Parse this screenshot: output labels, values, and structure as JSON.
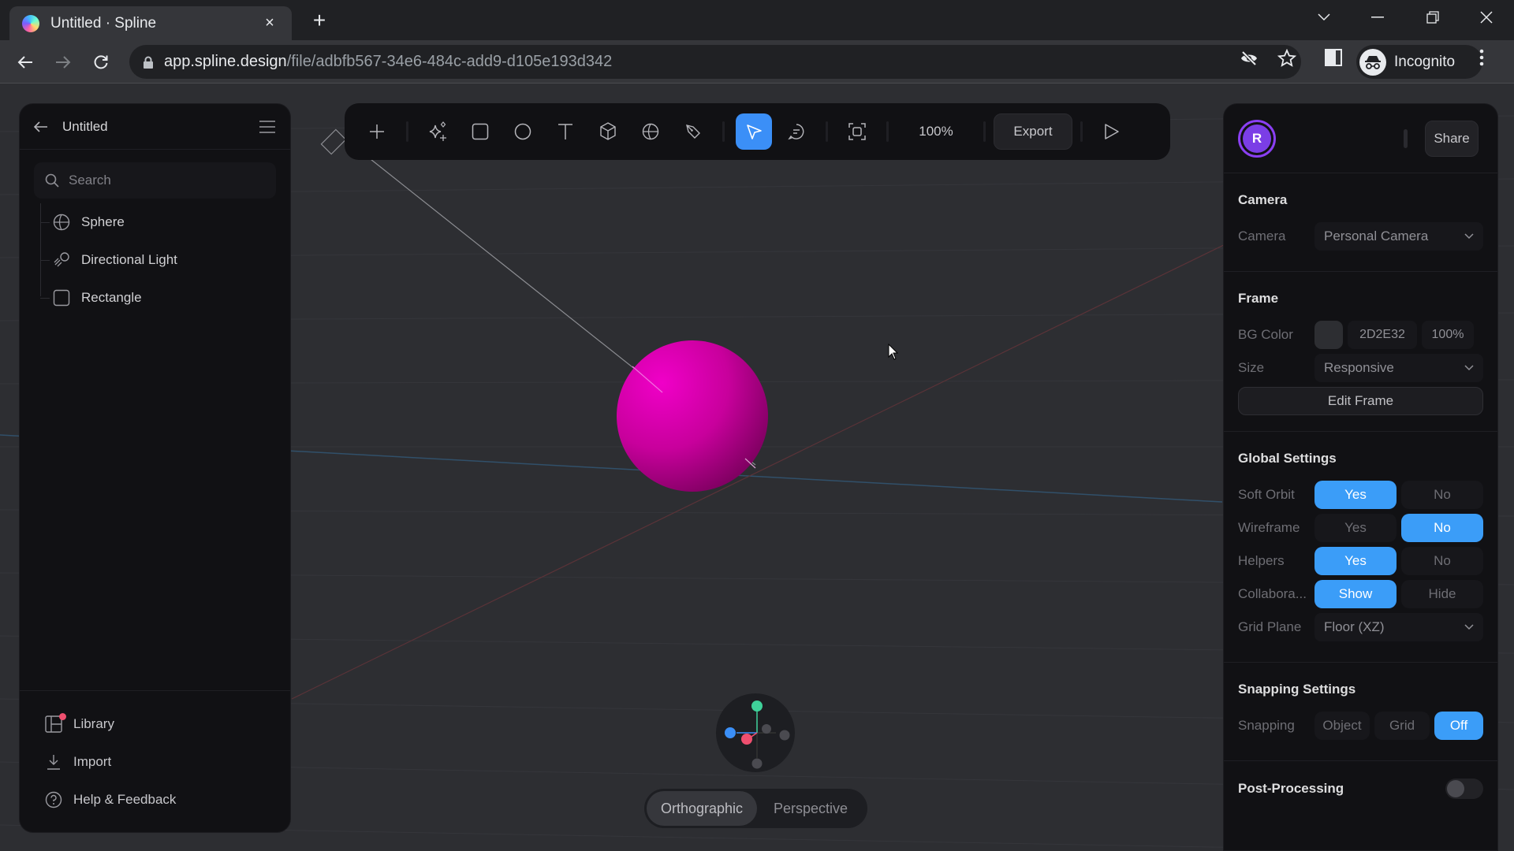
{
  "browser": {
    "tab_title": "Untitled · Spline",
    "tab_close": "×",
    "new_tab": "+",
    "url_host": "app.spline.design",
    "url_path": "/file/adbfb567-34e6-484c-add9-d105e193d342",
    "profile_label": "Incognito"
  },
  "left_panel": {
    "file_name": "Untitled",
    "search_placeholder": "Search",
    "objects": [
      {
        "label": "Sphere",
        "icon": "sphere-icon"
      },
      {
        "label": "Directional Light",
        "icon": "directional-light-icon"
      },
      {
        "label": "Rectangle",
        "icon": "rectangle-icon"
      }
    ],
    "footer": [
      {
        "label": "Library",
        "icon": "library-icon",
        "has_badge": true
      },
      {
        "label": "Import",
        "icon": "import-icon"
      },
      {
        "label": "Help & Feedback",
        "icon": "help-icon"
      }
    ]
  },
  "toolbar": {
    "tools": [
      "add",
      "ai-generate",
      "rectangle",
      "ellipse",
      "text",
      "cube",
      "sphere",
      "pen",
      "select",
      "comment",
      "frame",
      "zoom",
      "export",
      "play"
    ],
    "active_tool": "select",
    "zoom": "100%",
    "export_label": "Export"
  },
  "right_panel": {
    "user_initial": "R",
    "share_label": "Share",
    "camera": {
      "title": "Camera",
      "label": "Camera",
      "value": "Personal Camera"
    },
    "frame": {
      "title": "Frame",
      "bg_label": "BG Color",
      "bg_hex": "2D2E32",
      "bg_opacity": "100%",
      "size_label": "Size",
      "size_value": "Responsive",
      "edit_label": "Edit Frame"
    },
    "global": {
      "title": "Global Settings",
      "rows": [
        {
          "label": "Soft Orbit",
          "options": [
            "Yes",
            "No"
          ],
          "selected": 0
        },
        {
          "label": "Wireframe",
          "options": [
            "Yes",
            "No"
          ],
          "selected": 1
        },
        {
          "label": "Helpers",
          "options": [
            "Yes",
            "No"
          ],
          "selected": 0
        },
        {
          "label": "Collabora...",
          "options": [
            "Show",
            "Hide"
          ],
          "selected": 0
        }
      ],
      "grid_label": "Grid Plane",
      "grid_value": "Floor (XZ)"
    },
    "snapping": {
      "title": "Snapping Settings",
      "label": "Snapping",
      "options": [
        "Object",
        "Grid",
        "Off"
      ],
      "selected": 2
    },
    "post": {
      "title": "Post-Processing",
      "enabled": false
    }
  },
  "viewport": {
    "object_color": "#e000b8",
    "view_modes": [
      "Orthographic",
      "Perspective"
    ],
    "active_view": "Orthographic"
  },
  "colors": {
    "accent": "#3b9df8",
    "canvas_bg": "#2d2e32",
    "panel_bg": "#111114"
  }
}
